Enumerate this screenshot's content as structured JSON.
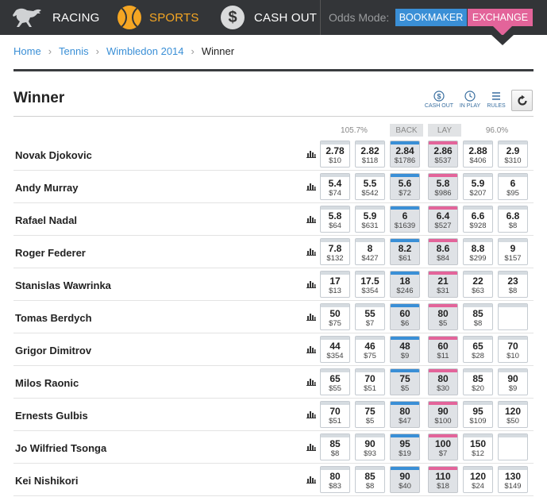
{
  "nav": {
    "racing_label": "RACING",
    "sports_label": "SPORTS",
    "cashout_label": "CASH OUT",
    "cashout_symbol": "$",
    "odds_mode_label": "Odds Mode:",
    "bookmaker_label": "BOOKMAKER",
    "exchange_label": "EXCHANGE",
    "active_mode": "EXCHANGE"
  },
  "breadcrumb": {
    "items": [
      "Home",
      "Tennis",
      "Wimbledon 2014"
    ],
    "current": "Winner"
  },
  "market": {
    "title": "Winner",
    "tools": {
      "cashout": "CASH OUT",
      "inplay": "IN PLAY",
      "rules": "RULES"
    }
  },
  "columns": {
    "back_percent": "105.7%",
    "back_label": "BACK",
    "lay_label": "LAY",
    "lay_percent": "96.0%"
  },
  "colors": {
    "nav_bg": "#333538",
    "sports_accent": "#f5a623",
    "back_blue": "#3a8fd6",
    "lay_pink": "#e3649a",
    "link_blue": "#3a8fd6"
  },
  "runners": [
    {
      "name": "Novak Djokovic",
      "prices": [
        [
          "2.78",
          "$10"
        ],
        [
          "2.82",
          "$118"
        ],
        [
          "2.84",
          "$1786"
        ],
        [
          "2.86",
          "$537"
        ],
        [
          "2.88",
          "$406"
        ],
        [
          "2.9",
          "$310"
        ]
      ]
    },
    {
      "name": "Andy Murray",
      "prices": [
        [
          "5.4",
          "$74"
        ],
        [
          "5.5",
          "$542"
        ],
        [
          "5.6",
          "$72"
        ],
        [
          "5.8",
          "$986"
        ],
        [
          "5.9",
          "$207"
        ],
        [
          "6",
          "$95"
        ]
      ]
    },
    {
      "name": "Rafael Nadal",
      "prices": [
        [
          "5.8",
          "$64"
        ],
        [
          "5.9",
          "$631"
        ],
        [
          "6",
          "$1639"
        ],
        [
          "6.4",
          "$527"
        ],
        [
          "6.6",
          "$928"
        ],
        [
          "6.8",
          "$8"
        ]
      ]
    },
    {
      "name": "Roger Federer",
      "prices": [
        [
          "7.8",
          "$132"
        ],
        [
          "8",
          "$427"
        ],
        [
          "8.2",
          "$61"
        ],
        [
          "8.6",
          "$84"
        ],
        [
          "8.8",
          "$299"
        ],
        [
          "9",
          "$157"
        ]
      ]
    },
    {
      "name": "Stanislas Wawrinka",
      "prices": [
        [
          "17",
          "$13"
        ],
        [
          "17.5",
          "$354"
        ],
        [
          "18",
          "$246"
        ],
        [
          "21",
          "$31"
        ],
        [
          "22",
          "$63"
        ],
        [
          "23",
          "$8"
        ]
      ]
    },
    {
      "name": "Tomas Berdych",
      "prices": [
        [
          "50",
          "$75"
        ],
        [
          "55",
          "$7"
        ],
        [
          "60",
          "$6"
        ],
        [
          "80",
          "$5"
        ],
        [
          "85",
          "$8"
        ],
        [
          "",
          ""
        ]
      ]
    },
    {
      "name": "Grigor Dimitrov",
      "prices": [
        [
          "44",
          "$354"
        ],
        [
          "46",
          "$75"
        ],
        [
          "48",
          "$9"
        ],
        [
          "60",
          "$11"
        ],
        [
          "65",
          "$28"
        ],
        [
          "70",
          "$10"
        ]
      ]
    },
    {
      "name": "Milos Raonic",
      "prices": [
        [
          "65",
          "$55"
        ],
        [
          "70",
          "$51"
        ],
        [
          "75",
          "$5"
        ],
        [
          "80",
          "$30"
        ],
        [
          "85",
          "$20"
        ],
        [
          "90",
          "$9"
        ]
      ]
    },
    {
      "name": "Ernests Gulbis",
      "prices": [
        [
          "70",
          "$51"
        ],
        [
          "75",
          "$5"
        ],
        [
          "80",
          "$47"
        ],
        [
          "90",
          "$100"
        ],
        [
          "95",
          "$109"
        ],
        [
          "120",
          "$50"
        ]
      ]
    },
    {
      "name": "Jo Wilfried Tsonga",
      "prices": [
        [
          "85",
          "$8"
        ],
        [
          "90",
          "$93"
        ],
        [
          "95",
          "$19"
        ],
        [
          "100",
          "$7"
        ],
        [
          "150",
          "$12"
        ],
        [
          "",
          ""
        ]
      ]
    },
    {
      "name": "Kei Nishikori",
      "prices": [
        [
          "80",
          "$83"
        ],
        [
          "85",
          "$8"
        ],
        [
          "90",
          "$40"
        ],
        [
          "110",
          "$18"
        ],
        [
          "120",
          "$24"
        ],
        [
          "130",
          "$149"
        ]
      ]
    }
  ]
}
